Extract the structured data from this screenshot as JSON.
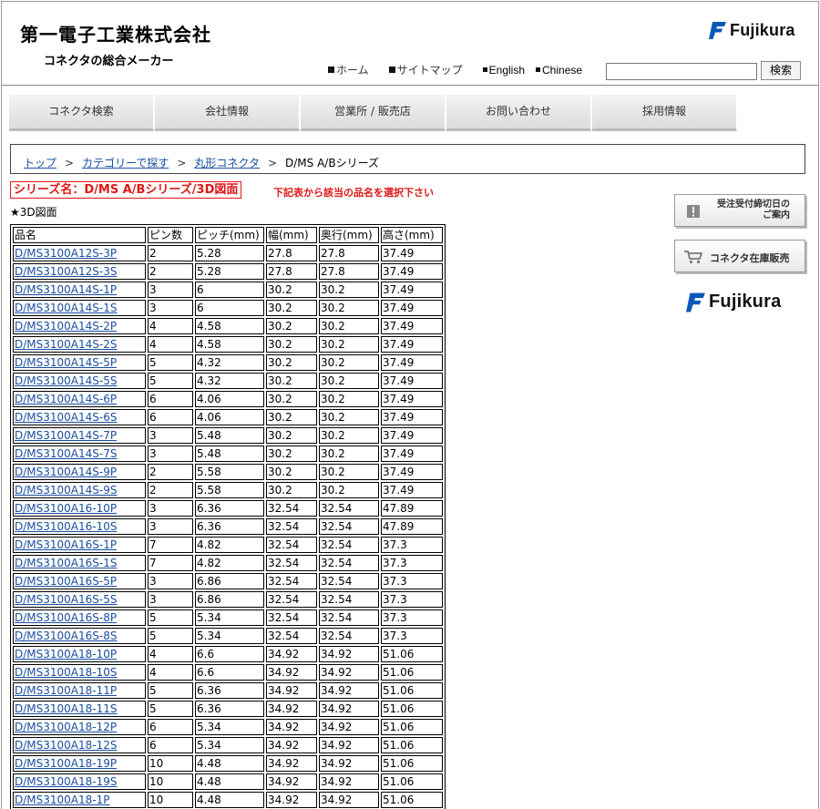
{
  "header": {
    "company_name": "第一電子工業株式会社",
    "tagline": "コネクタの総合メーカー",
    "logo_text": "Fujikura",
    "links": [
      {
        "label": "ホーム"
      },
      {
        "label": "サイトマップ"
      },
      {
        "label": "English"
      },
      {
        "label": "Chinese"
      }
    ],
    "search_placeholder": "",
    "search_button": "検索"
  },
  "nav": {
    "tabs": [
      "コネクタ検索",
      "会社情報",
      "営業所 / 販売店",
      "お問い合わせ",
      "採用情報"
    ]
  },
  "breadcrumb": {
    "items": [
      "トップ",
      "カテゴリーで探す",
      "丸形コネクタ",
      "D/MS A/Bシリーズ"
    ],
    "separator": ">"
  },
  "series": {
    "title": "シリーズ名：D/MS A/Bシリーズ/3D図面",
    "note": "下記表から該当の品名を選択下さい",
    "section_label": "★3D図面"
  },
  "table": {
    "headers": [
      "品名",
      "ピン数",
      "ピッチ(mm)",
      "幅(mm)",
      "奥行(mm)",
      "高さ(mm)"
    ],
    "rows": [
      [
        "D/MS3100A12S-3P",
        "2",
        "5.28",
        "27.8",
        "27.8",
        "37.49"
      ],
      [
        "D/MS3100A12S-3S",
        "2",
        "5.28",
        "27.8",
        "27.8",
        "37.49"
      ],
      [
        "D/MS3100A14S-1P",
        "3",
        "6",
        "30.2",
        "30.2",
        "37.49"
      ],
      [
        "D/MS3100A14S-1S",
        "3",
        "6",
        "30.2",
        "30.2",
        "37.49"
      ],
      [
        "D/MS3100A14S-2P",
        "4",
        "4.58",
        "30.2",
        "30.2",
        "37.49"
      ],
      [
        "D/MS3100A14S-2S",
        "4",
        "4.58",
        "30.2",
        "30.2",
        "37.49"
      ],
      [
        "D/MS3100A14S-5P",
        "5",
        "4.32",
        "30.2",
        "30.2",
        "37.49"
      ],
      [
        "D/MS3100A14S-5S",
        "5",
        "4.32",
        "30.2",
        "30.2",
        "37.49"
      ],
      [
        "D/MS3100A14S-6P",
        "6",
        "4.06",
        "30.2",
        "30.2",
        "37.49"
      ],
      [
        "D/MS3100A14S-6S",
        "6",
        "4.06",
        "30.2",
        "30.2",
        "37.49"
      ],
      [
        "D/MS3100A14S-7P",
        "3",
        "5.48",
        "30.2",
        "30.2",
        "37.49"
      ],
      [
        "D/MS3100A14S-7S",
        "3",
        "5.48",
        "30.2",
        "30.2",
        "37.49"
      ],
      [
        "D/MS3100A14S-9P",
        "2",
        "5.58",
        "30.2",
        "30.2",
        "37.49"
      ],
      [
        "D/MS3100A14S-9S",
        "2",
        "5.58",
        "30.2",
        "30.2",
        "37.49"
      ],
      [
        "D/MS3100A16-10P",
        "3",
        "6.36",
        "32.54",
        "32.54",
        "47.89"
      ],
      [
        "D/MS3100A16-10S",
        "3",
        "6.36",
        "32.54",
        "32.54",
        "47.89"
      ],
      [
        "D/MS3100A16S-1P",
        "7",
        "4.82",
        "32.54",
        "32.54",
        "37.3"
      ],
      [
        "D/MS3100A16S-1S",
        "7",
        "4.82",
        "32.54",
        "32.54",
        "37.3"
      ],
      [
        "D/MS3100A16S-5P",
        "3",
        "6.86",
        "32.54",
        "32.54",
        "37.3"
      ],
      [
        "D/MS3100A16S-5S",
        "3",
        "6.86",
        "32.54",
        "32.54",
        "37.3"
      ],
      [
        "D/MS3100A16S-8P",
        "5",
        "5.34",
        "32.54",
        "32.54",
        "37.3"
      ],
      [
        "D/MS3100A16S-8S",
        "5",
        "5.34",
        "32.54",
        "32.54",
        "37.3"
      ],
      [
        "D/MS3100A18-10P",
        "4",
        "6.6",
        "34.92",
        "34.92",
        "51.06"
      ],
      [
        "D/MS3100A18-10S",
        "4",
        "6.6",
        "34.92",
        "34.92",
        "51.06"
      ],
      [
        "D/MS3100A18-11P",
        "5",
        "6.36",
        "34.92",
        "34.92",
        "51.06"
      ],
      [
        "D/MS3100A18-11S",
        "5",
        "6.36",
        "34.92",
        "34.92",
        "51.06"
      ],
      [
        "D/MS3100A18-12P",
        "6",
        "5.34",
        "34.92",
        "34.92",
        "51.06"
      ],
      [
        "D/MS3100A18-12S",
        "6",
        "5.34",
        "34.92",
        "34.92",
        "51.06"
      ],
      [
        "D/MS3100A18-19P",
        "10",
        "4.48",
        "34.92",
        "34.92",
        "51.06"
      ],
      [
        "D/MS3100A18-19S",
        "10",
        "4.48",
        "34.92",
        "34.92",
        "51.06"
      ],
      [
        "D/MS3100A18-1P",
        "10",
        "4.48",
        "34.92",
        "34.92",
        "51.06"
      ]
    ]
  },
  "sidebar": {
    "deadline_button": [
      "受注受付締切日の",
      "ご案内"
    ],
    "stock_button": "コネクタ在庫販売",
    "logo_text": "Fujikura"
  },
  "colors": {
    "link": "#1a4ea0",
    "accent_red": "#e01818",
    "brand_blue": "#0a58b8"
  }
}
